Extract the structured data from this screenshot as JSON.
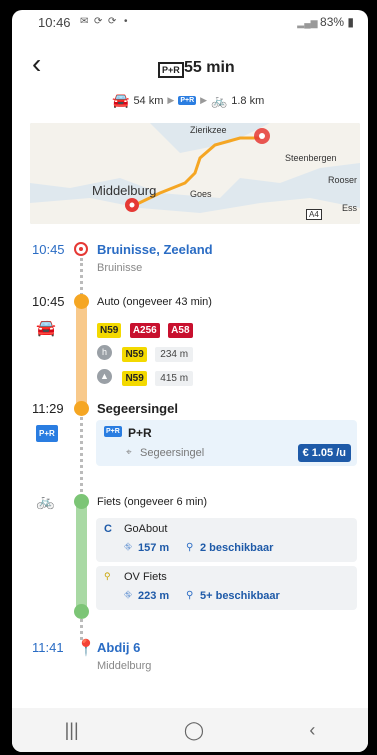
{
  "status": {
    "time": "10:46",
    "battery": "83%"
  },
  "header": {
    "badge": "P+R",
    "duration": "55 min",
    "car_km": "54 km",
    "bike_km": "1.8 km",
    "pr_mini": "P+R"
  },
  "map": {
    "labels": [
      "Zierikzee",
      "Steenbergen",
      "Middelburg",
      "Goes",
      "Rooser",
      "A4",
      "Ess"
    ]
  },
  "trip": {
    "start": {
      "time": "10:45",
      "place": "Bruinisse, Zeeland",
      "sub": "Bruinisse"
    },
    "car": {
      "time": "10:45",
      "label": "Auto (ongeveer 43 min)",
      "roads": [
        "N59",
        "A256",
        "A58"
      ],
      "steps": [
        {
          "icon": "h",
          "road": "N59",
          "dist": "234 m"
        },
        {
          "icon": "▲",
          "road": "N59",
          "dist": "415 m"
        }
      ]
    },
    "transfer": {
      "time": "11:29",
      "place": "Segeersingel",
      "pr_icon": "P+R",
      "card": {
        "icon": "P+R",
        "title": "P+R",
        "sub": "Segeersingel",
        "price": "€ 1.05 /u"
      }
    },
    "bike": {
      "label": "Fiets (ongeveer 6 min)",
      "options": [
        {
          "name": "GoAbout",
          "dist": "157 m",
          "avail": "2 beschikbaar"
        },
        {
          "name": "OV Fiets",
          "dist": "223 m",
          "avail": "5+ beschikbaar"
        }
      ]
    },
    "end": {
      "time": "11:41",
      "place": "Abdij 6",
      "sub": "Middelburg"
    }
  },
  "colors": {
    "blue": "#2a6cc4",
    "orange": "#f5a623",
    "green": "#7cc576",
    "red": "#e53935"
  }
}
